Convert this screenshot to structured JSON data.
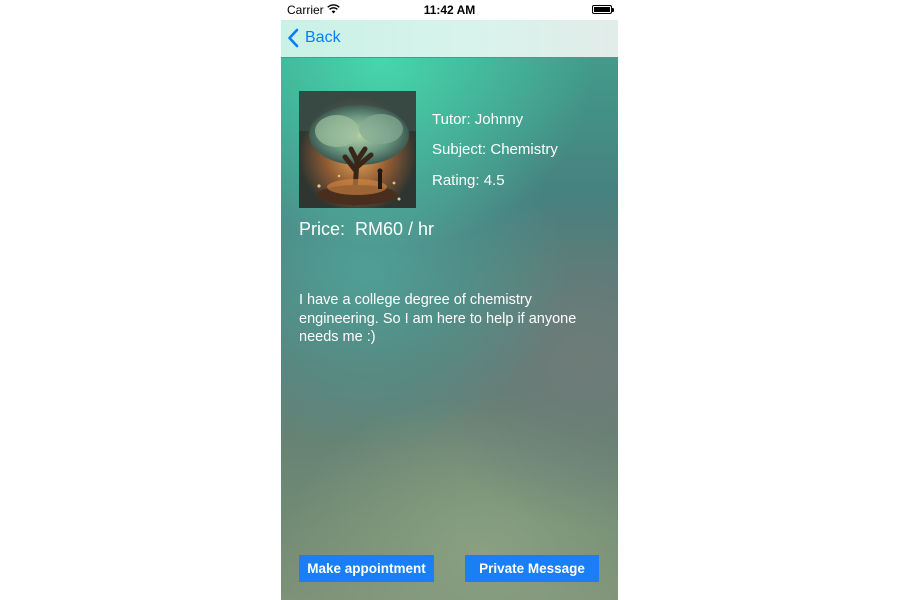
{
  "status_bar": {
    "carrier": "Carrier",
    "time": "11:42 AM"
  },
  "nav": {
    "back_label": "Back"
  },
  "tutor": {
    "photo_icon": "tree-artwork",
    "tutor_line": "Tutor: Johnny",
    "subject_line": "Subject: Chemistry",
    "rating_line": "Rating: 4.5",
    "price_line": "Price:  RM60 / hr",
    "description": "I have a college degree of chemistry engineering. So I am here to help if anyone needs me :)"
  },
  "actions": {
    "appointment_label": "Make appointment",
    "message_label": "Private Message"
  },
  "colors": {
    "accent": "#0a7bff",
    "button_bg": "#1a7ef5"
  }
}
